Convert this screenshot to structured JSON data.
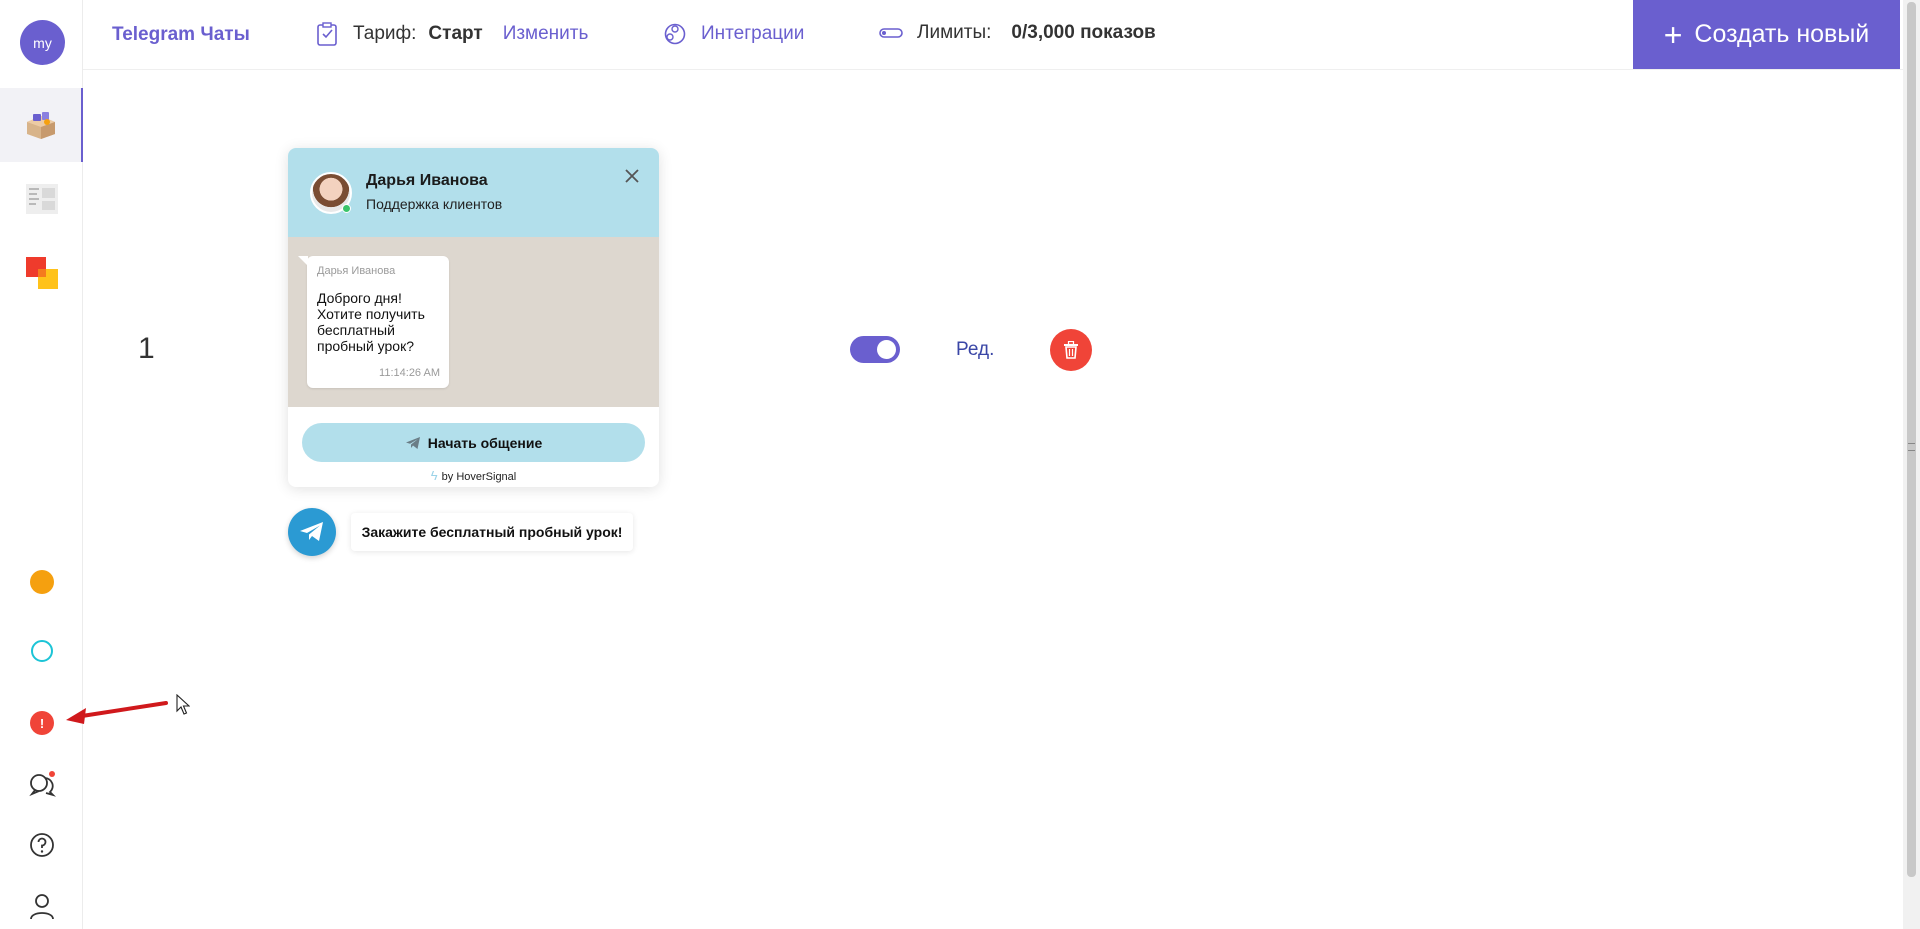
{
  "sidebar": {
    "avatar_text": "my",
    "accent": "#6a5fcf",
    "items": [
      {
        "name": "widgets",
        "icon": "box-icon",
        "active": true
      },
      {
        "name": "reports",
        "icon": "document-icon",
        "active": false
      },
      {
        "name": "apps",
        "icon": "squares-icon",
        "active": false
      }
    ],
    "bottom": [
      {
        "icon": "orange-dot-icon",
        "color": "#f5a00f"
      },
      {
        "icon": "cyan-ring-icon",
        "color": "#1cc4d6"
      },
      {
        "icon": "alert-icon",
        "color": "#f04438",
        "text": "!"
      },
      {
        "icon": "chat-icon"
      },
      {
        "icon": "help-icon"
      },
      {
        "icon": "user-icon"
      }
    ]
  },
  "header": {
    "brand": "Telegram Чаты",
    "tariff_label": "Тариф:",
    "tariff_value": "Старт",
    "change_link": "Изменить",
    "integrations": "Интеграции",
    "limits_label": "Лимиты:",
    "limits_value": "0/3,000 показов",
    "create_button": "Создать новый",
    "create_plus": "+"
  },
  "row": {
    "number": "1",
    "enabled": true,
    "edit_label": "Ред."
  },
  "widget": {
    "agent_name": "Дарья Иванова",
    "agent_role": "Поддержка клиентов",
    "message_author": "Дарья Иванова",
    "message_text": "Доброго дня! Хотите получить бесплатный пробный урок?",
    "message_time": "11:14:26 AM",
    "start_button": "Начать общение",
    "powered_by": "by HoverSignal",
    "bubble_label": "Закажите бесплатный пробный урок!",
    "header_color": "#b2dfeb",
    "telegram_color": "#2b9ad3"
  },
  "colors": {
    "danger": "#f04438",
    "link": "#3a46a6"
  }
}
